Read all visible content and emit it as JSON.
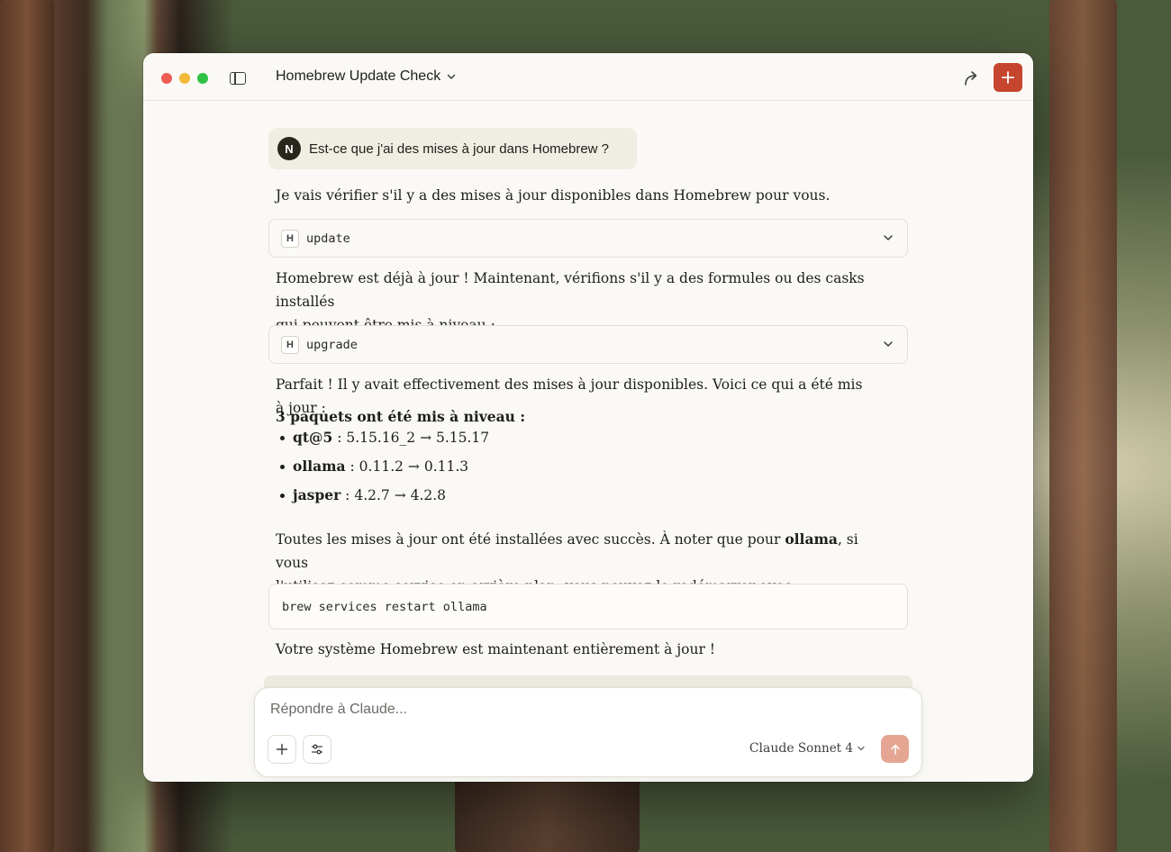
{
  "window": {
    "title": "Homebrew Update Check",
    "accent_color": "#c6452e"
  },
  "conversation": {
    "user": {
      "avatar_initial": "N",
      "message": "Est-ce que j'ai des mises à jour dans Homebrew ?"
    },
    "intro": "Je vais vérifier s'il y a des mises à jour disponibles dans Homebrew pour vous.",
    "tool_update": {
      "icon_letter": "H",
      "name": "update"
    },
    "after_update_line1": "Homebrew est déjà à jour ! Maintenant, vérifions s'il y a des formules ou des casks installés",
    "after_update_line2": "qui peuvent être mis à niveau :",
    "tool_upgrade": {
      "icon_letter": "H",
      "name": "upgrade"
    },
    "after_upgrade": "Parfait ! Il y avait effectivement des mises à jour disponibles. Voici ce qui a été mis à jour :",
    "packages_heading": "3 paquets ont été mis à niveau :",
    "packages": [
      {
        "name": "qt@5",
        "versions": " : 5.15.16_2 → 5.15.17"
      },
      {
        "name": "ollama",
        "versions": " : 0.11.2 → 0.11.3"
      },
      {
        "name": "jasper",
        "versions": " : 4.2.7 → 4.2.8"
      }
    ],
    "note_part1": "Toutes les mises à jour ont été installées avec succès. À noter que pour ",
    "note_bold": "ollama",
    "note_part2": ", si vous",
    "note_line2": "l'utilisez comme service en arrière-plan, vous pouvez le redémarrer avec :",
    "code": "brew services restart ollama",
    "closing": "Votre système Homebrew est maintenant entièrement à jour !"
  },
  "composer": {
    "placeholder": "Répondre à Claude...",
    "model_name_a": "Claude",
    "model_name_b": " Sonnet 4"
  }
}
